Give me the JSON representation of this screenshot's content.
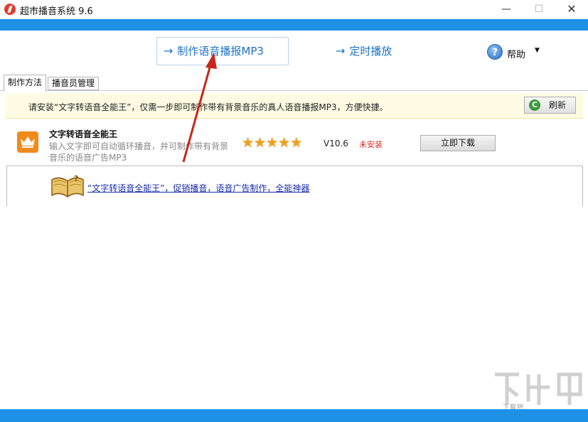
{
  "window": {
    "title": "超市播音系统 9.6",
    "controls": {
      "minimize": "—",
      "maximize": "☐",
      "close": "✕"
    },
    "accent_color": "#1e90e6"
  },
  "nav": {
    "make_mp3": {
      "arrow": "→",
      "label": "制作语音播报MP3"
    },
    "schedule": {
      "arrow": "→",
      "label": "定时播放"
    },
    "help": {
      "icon": "?",
      "label": "帮助",
      "caret": "▼"
    }
  },
  "tabs": [
    {
      "label": "制作方法",
      "active": true
    },
    {
      "label": "播音员管理",
      "active": false
    }
  ],
  "notice": {
    "text": "请安装“文字转语音全能王”，仅需一步即可制作带有背景音乐的真人语音播报MP3，方便快捷。",
    "refresh_label": "刷新",
    "refresh_icon": "C"
  },
  "product": {
    "icon": "crown-icon",
    "name": "文字转语音全能王",
    "description": "输入文字即可自动循环播音，并可制作带有背景音乐的语音广告MP3",
    "rating": 5,
    "star_glyph": "★",
    "version": "V10.6",
    "status": "未安装",
    "status_color": "#d52b1e",
    "download_label": "立即下载"
  },
  "info": {
    "icon": "book-icon",
    "link_text": "“文字转语音全能王”，促销播音，语音广告制作，全能神器"
  },
  "watermark": {
    "text": "下载吧"
  }
}
